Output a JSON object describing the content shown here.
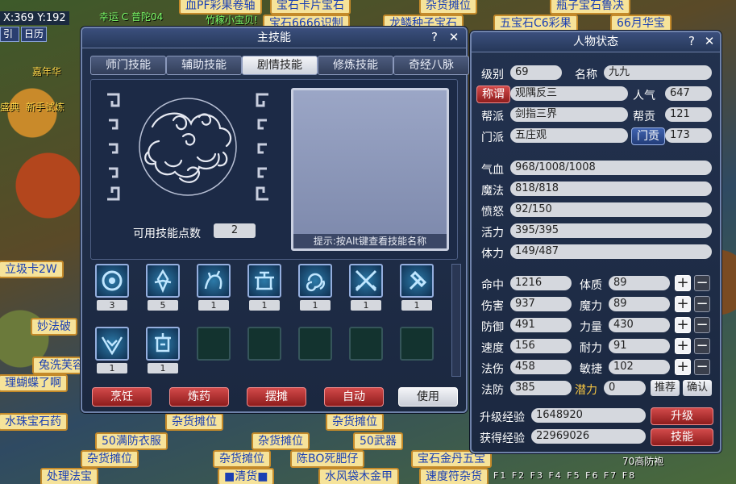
{
  "hud": {
    "coords": "X:369 Y:192",
    "nav_left": "引",
    "nav_calendar": "日历"
  },
  "background_labels": [
    "血PF彩果卷轴",
    "宝石卡片宝石",
    "杂货摊位",
    "瓶子宝石鲁决",
    "宝石6666识制",
    "龙鳞种子宝石",
    "五宝石C6彩果",
    "66月华宝",
    "幸运 C 普陀04",
    "竹稼小宝贝!",
    "立圾卡2W",
    "妙法破",
    "兔洗芙容",
    "理蝴蝶了啊",
    "水珠宝石药",
    "杂货摊位",
    "杂货摊位",
    "50满防衣服",
    "杂货摊位",
    "50武器",
    "杂货摊位",
    "杂货摊位",
    "陈BO死肥仔",
    "宝石金丹五宝",
    "处理法宝",
    "■清货■",
    "水风袋木金甲",
    "速度符杂货",
    "嘉年华",
    "盛典",
    "新手试炼",
    "70高防袍"
  ],
  "fkeys": "F1 F2 F3 F4 F5 F6 F7 F8",
  "skill_window": {
    "title": "主技能",
    "tabs": [
      {
        "label": "师门技能",
        "active": false
      },
      {
        "label": "辅助技能",
        "active": false
      },
      {
        "label": "剧情技能",
        "active": true
      },
      {
        "label": "修炼技能",
        "active": false
      },
      {
        "label": "奇经八脉",
        "active": false
      }
    ],
    "points_label": "可用技能点数",
    "points_value": "2",
    "hint": "提示:按Alt键查看技能名称",
    "skills": [
      {
        "icon": "ring-skill-icon",
        "level": "3"
      },
      {
        "icon": "demon-skill-icon",
        "level": "5"
      },
      {
        "icon": "beast-skill-icon",
        "level": "1"
      },
      {
        "icon": "altar-skill-icon",
        "level": "1"
      },
      {
        "icon": "swirl-skill-icon",
        "level": "1"
      },
      {
        "icon": "crossed-swords-skill-icon",
        "level": "1"
      },
      {
        "icon": "hammer-skill-icon",
        "level": "1"
      },
      {
        "icon": "wings-skill-icon",
        "level": "1"
      },
      {
        "icon": "lantern-skill-icon",
        "level": "1"
      }
    ],
    "buttons": [
      "烹饪",
      "炼药",
      "摆摊",
      "自动",
      "使用"
    ]
  },
  "status_window": {
    "title": "人物状态",
    "level_label": "级别",
    "level": "69",
    "name_label": "名称",
    "name": "九九",
    "title_label": "称谓",
    "char_title": "观隅反三",
    "popularity_label": "人气",
    "popularity": "647",
    "faction_label": "帮派",
    "faction": "剑指三界",
    "contribution_label": "帮贡",
    "contribution": "121",
    "school_label": "门派",
    "school": "五庄观",
    "school_contribution_label": "门贡",
    "school_contribution": "173",
    "hp_label": "气血",
    "hp": "968/1008/1008",
    "mp_label": "魔法",
    "mp": "818/818",
    "rage_label": "愤怒",
    "rage": "92/150",
    "vitality_label": "活力",
    "vitality": "395/395",
    "stamina_label": "体力",
    "stamina": "149/487",
    "combat": [
      {
        "label": "命中",
        "value": "1216"
      },
      {
        "label": "伤害",
        "value": "937"
      },
      {
        "label": "防御",
        "value": "491"
      },
      {
        "label": "速度",
        "value": "156"
      },
      {
        "label": "法伤",
        "value": "458"
      },
      {
        "label": "法防",
        "value": "385"
      }
    ],
    "attributes": [
      {
        "label": "体质",
        "value": "89"
      },
      {
        "label": "魔力",
        "value": "89"
      },
      {
        "label": "力量",
        "value": "430"
      },
      {
        "label": "耐力",
        "value": "91"
      },
      {
        "label": "敏捷",
        "value": "102"
      }
    ],
    "potential_label": "潜力",
    "potential": "0",
    "recommend_label": "推荐",
    "confirm_label": "确认",
    "upgrade_exp_label": "升级经验",
    "upgrade_exp": "1648920",
    "gained_exp_label": "获得经验",
    "gained_exp": "22969026",
    "upgrade_button": "升级",
    "skill_button": "技能",
    "colors": {
      "potential_label": "#f5c542",
      "red_button": "#b52a2a",
      "blue_button": "#2e4d96"
    }
  }
}
